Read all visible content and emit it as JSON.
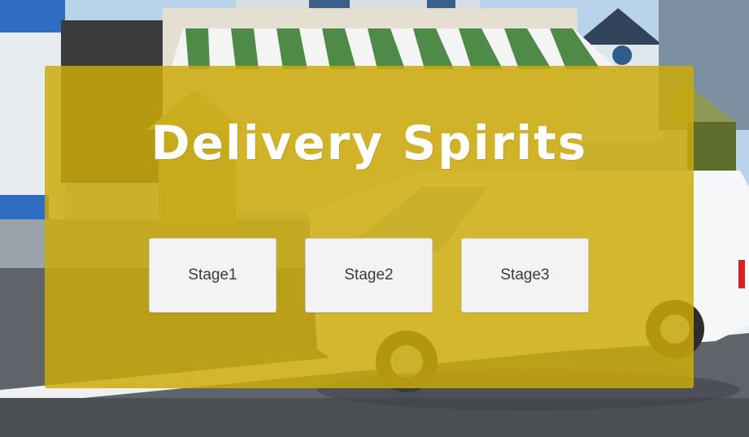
{
  "game": {
    "title": "Delivery Spirits"
  },
  "menu": {
    "stages": [
      {
        "label": "Stage1"
      },
      {
        "label": "Stage2"
      },
      {
        "label": "Stage3"
      }
    ]
  },
  "colors": {
    "panel_overlay": "#ccaa08",
    "button_bg": "#f3f3f3",
    "button_text": "#3a3a3a",
    "title_text": "#ffffff",
    "awning_green": "#4f8a48",
    "road": "#5f636a"
  }
}
